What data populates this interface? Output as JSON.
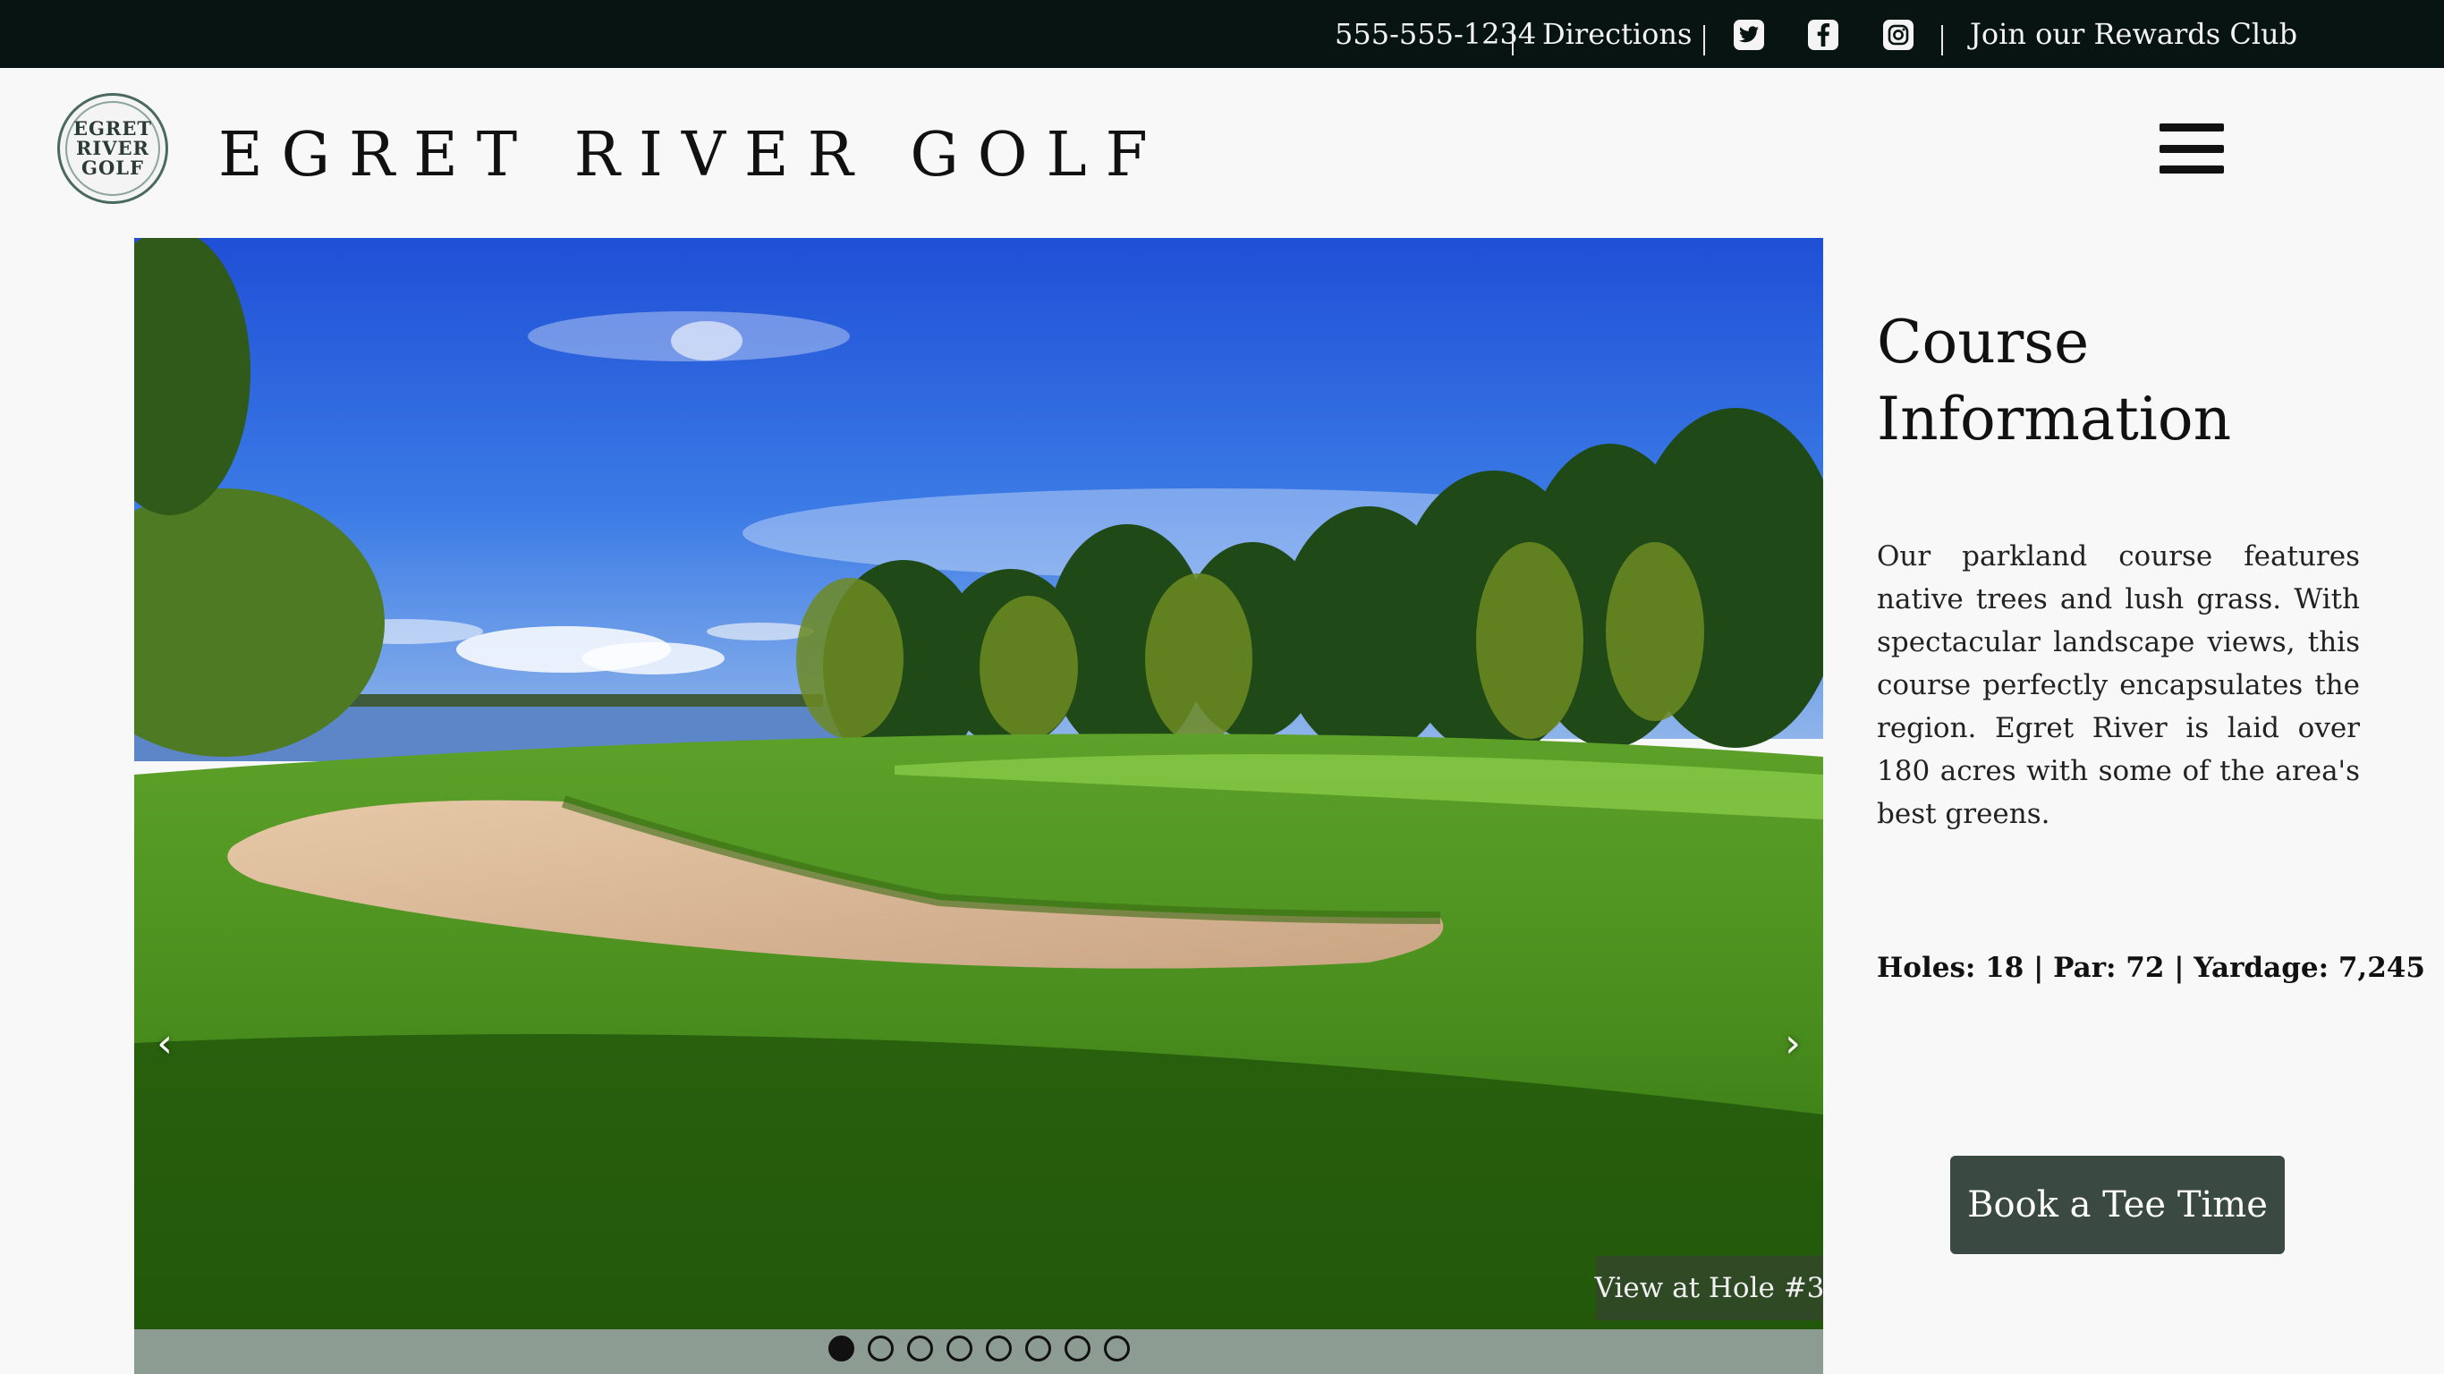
{
  "topbar": {
    "phone": "555-555-1234",
    "directions": "Directions",
    "social": [
      {
        "icon": "twitter-icon",
        "glyph": "🐦"
      },
      {
        "icon": "facebook-icon",
        "glyph": "f"
      },
      {
        "icon": "instagram-icon",
        "glyph": "◎"
      }
    ],
    "rewards": "Join our Rewards Club"
  },
  "header": {
    "logo_lines": [
      "EGRET",
      "RIVER",
      "GOLF"
    ],
    "brand": "EGRET RIVER GOLF",
    "menu_icon": "hamburger-menu-icon"
  },
  "hero": {
    "prev_glyph": "‹",
    "next_glyph": "›",
    "caption": "View at Hole #3",
    "slide_count": 8,
    "active_slide": 1
  },
  "info": {
    "title": "Course Information",
    "body": "Our parkland course features native trees and lush grass. With spectacular landscape views, this course perfectly encapsulates the region. Egret River is laid over 180 acres with some of the area's best greens.",
    "stats": "Holes: 18 | Par: 72 | Yardage: 7,245",
    "cta": "Book a Tee Time"
  },
  "colors": {
    "topbar_bg": "#071411",
    "button_bg": "#3a4a42",
    "dotbar_bg": "#8d9c92",
    "page_bg": "#f8f8f8"
  }
}
